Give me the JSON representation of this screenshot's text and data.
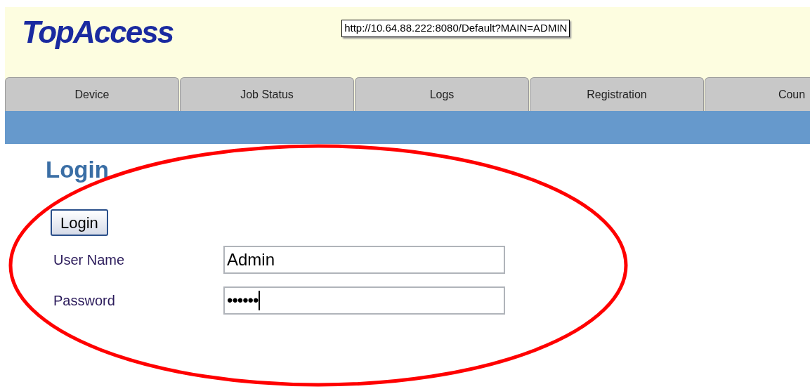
{
  "header": {
    "logo": "TopAccess",
    "tooltip": "http://10.64.88.222:8080/Default?MAIN=ADMIN"
  },
  "tabs": [
    {
      "label": "Device",
      "selected": false
    },
    {
      "label": "Job Status",
      "selected": false
    },
    {
      "label": "Logs",
      "selected": false
    },
    {
      "label": "Registration",
      "selected": false
    },
    {
      "label": "Coun",
      "selected": false
    }
  ],
  "login": {
    "title": "Login",
    "button": "Login",
    "fields": [
      {
        "label": "User Name",
        "value": "Admin",
        "kind": "text"
      },
      {
        "label": "Password",
        "value": "••••••",
        "kind": "password"
      }
    ]
  }
}
